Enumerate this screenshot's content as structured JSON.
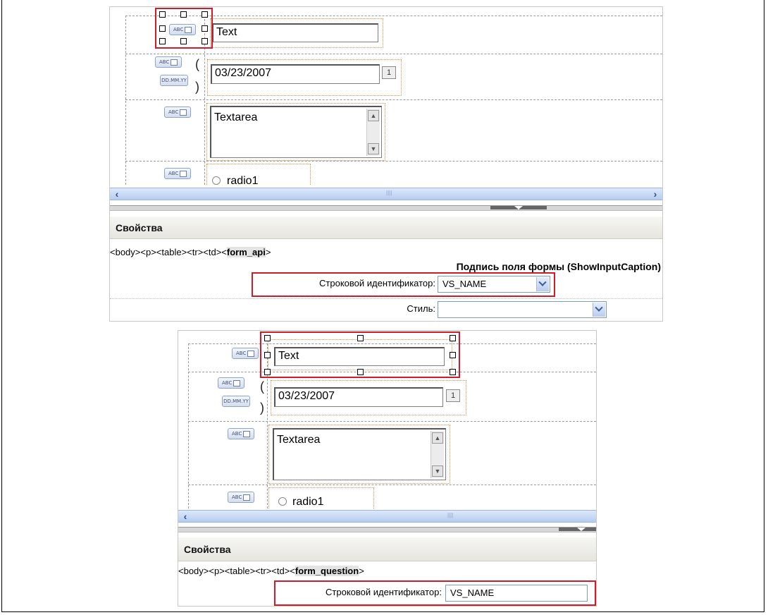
{
  "panels": [
    {
      "fields": {
        "text_value": "Text",
        "date_value": "03/23/2007",
        "calendar_btn": "1",
        "textarea_value": "Textarea",
        "radio_label": "radio1",
        "abc_label": "ABC",
        "date_fmt_label": "DD.MM.YY"
      },
      "properties": {
        "title": "Свойства",
        "crumbs_prefix": "<body><p><table><tr><td><",
        "crumbs_current": "form_api",
        "crumbs_suffix": ">",
        "section_title": "Подпись поля формы (ShowInputCaption)",
        "id_label": "Строковой идентификатор:",
        "id_value": "VS_NAME",
        "style_label": "Стиль:",
        "style_value": ""
      }
    },
    {
      "fields": {
        "text_value": "Text",
        "date_value": "03/23/2007",
        "calendar_btn": "1",
        "textarea_value": "Textarea",
        "radio_label": "radio1",
        "abc_label": "ABC",
        "date_fmt_label": "DD.MM.YY"
      },
      "properties": {
        "title": "Свойства",
        "crumbs_prefix": "<body><p><table><tr><td><",
        "crumbs_current": "form_question",
        "crumbs_suffix": ">",
        "id_label": "Строковой идентификатор:",
        "id_value": "VS_NAME"
      }
    }
  ],
  "colors": {
    "highlight": "#d01c2a",
    "dashed_orange": "#e09040",
    "scrollbar": "#b6ccef"
  }
}
